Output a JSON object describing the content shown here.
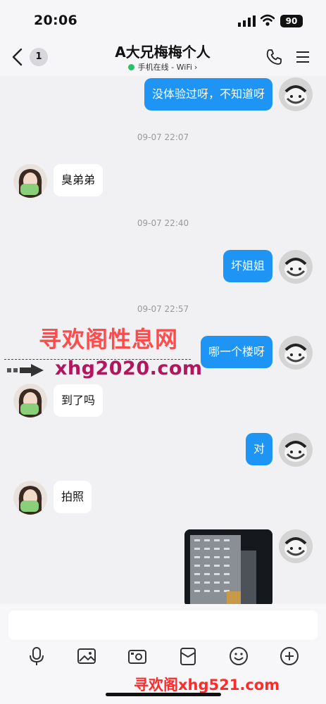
{
  "status_bar": {
    "time": "20:06",
    "battery": "90"
  },
  "header": {
    "title": "A大兄梅梅个人",
    "unread_count": "1",
    "presence": "手机在线 - WiFi"
  },
  "messages": [
    {
      "side": "out",
      "text": "没体验过呀，不知道呀"
    },
    {
      "timestamp": "09-07 22:07"
    },
    {
      "side": "in",
      "text": "臭弟弟"
    },
    {
      "timestamp": "09-07 22:40"
    },
    {
      "side": "out",
      "text": "坏姐姐"
    },
    {
      "timestamp": "09-07 22:57"
    },
    {
      "side": "out",
      "text": "哪一个楼呀"
    },
    {
      "side": "in",
      "text": "到了吗"
    },
    {
      "side": "out",
      "text": "对"
    },
    {
      "side": "in",
      "text": "拍照"
    },
    {
      "side": "out",
      "type": "photo"
    }
  ],
  "watermark": {
    "title": "寻欢阁性息网",
    "url": "xhg2020.com",
    "bottom": "寻欢阁xhg521.com"
  },
  "colors": {
    "accent": "#1e94f4",
    "online": "#27c26a"
  },
  "toolbar_icons": [
    "microphone-icon",
    "image-icon",
    "camera-icon",
    "red-packet-icon",
    "emoji-icon",
    "plus-icon"
  ]
}
